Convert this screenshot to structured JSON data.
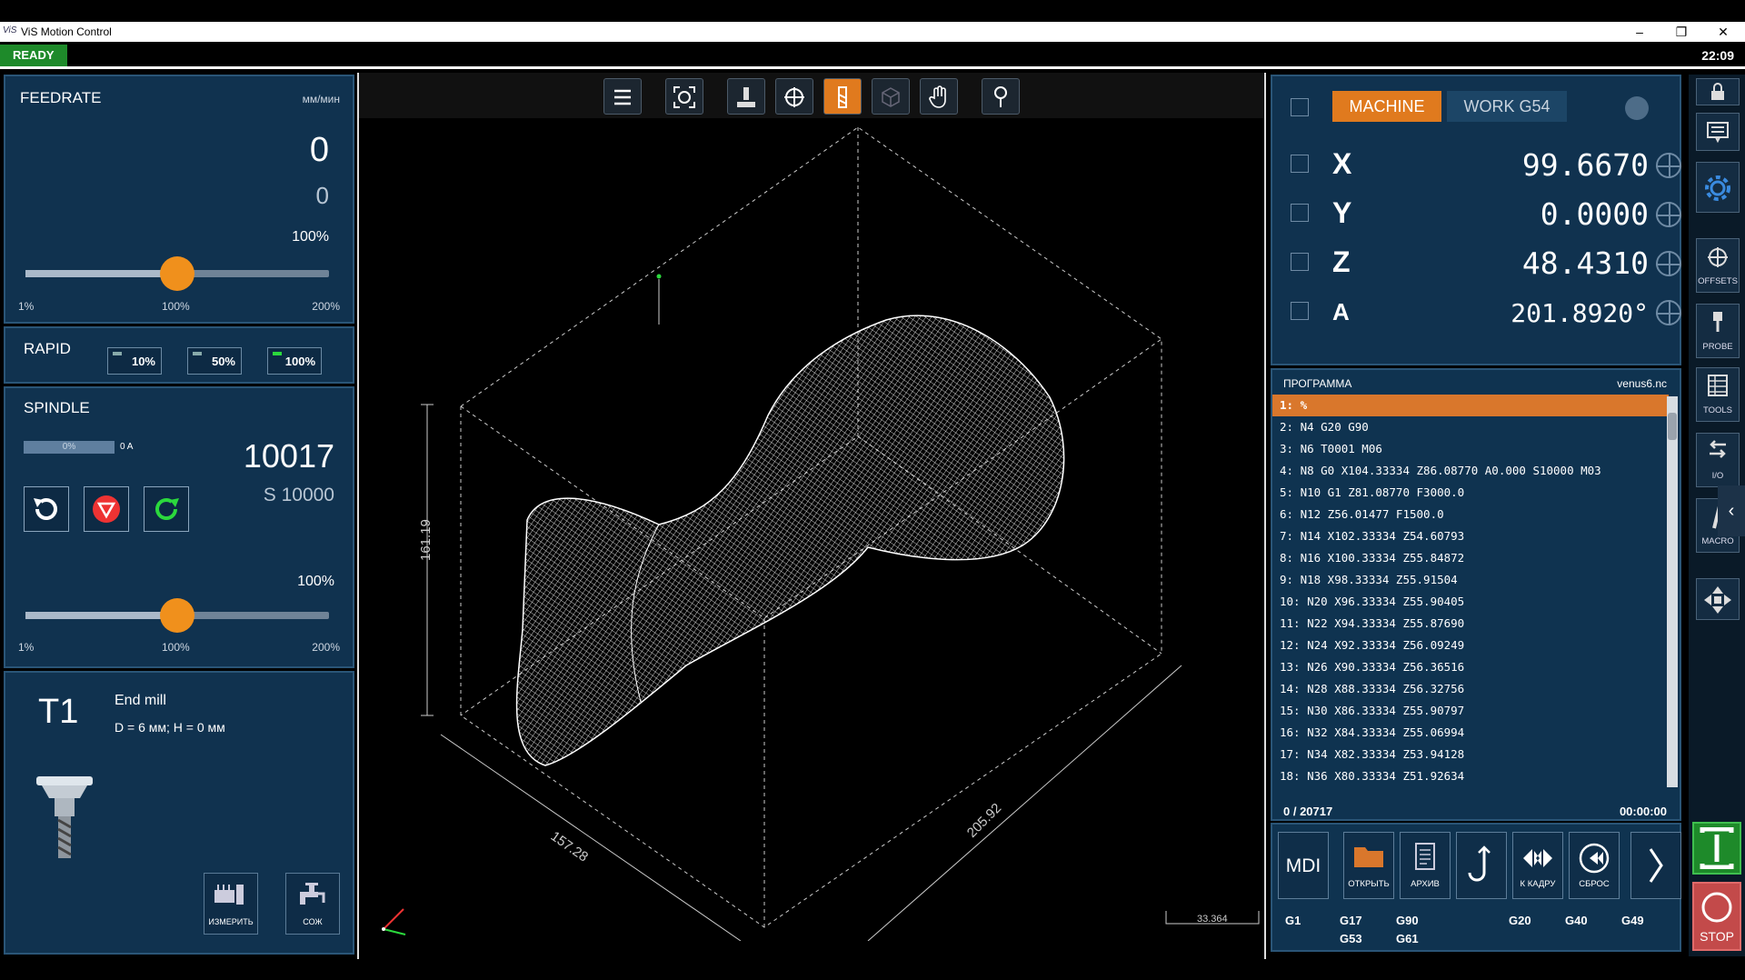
{
  "window": {
    "logo": "ViS",
    "title": "ViS Motion Control",
    "min": "–",
    "max": "❐",
    "close": "✕"
  },
  "status": {
    "state": "READY",
    "clock": "22:09"
  },
  "feedrate": {
    "title": "FEEDRATE",
    "unit": "мм/мин",
    "value": "0",
    "set": "0",
    "percent": "100%",
    "slider_level": 0.5,
    "min": "1%",
    "mid": "100%",
    "max": "200%"
  },
  "rapid": {
    "title": "RAPID",
    "btn1": "10%",
    "btn2": "50%",
    "btn3": "100%",
    "active": "100%"
  },
  "spindle": {
    "title": "SPINDLE",
    "load": "0%",
    "amp": "0 A",
    "rpm": "10017",
    "set": "S 10000",
    "percent": "100%",
    "slider_level": 0.5,
    "min": "1%",
    "mid": "100%",
    "max": "200%"
  },
  "tool": {
    "number": "T1",
    "name": "End mill",
    "dims": "D = 6 мм; H = 0 мм",
    "measure": "ИЗМЕРИТЬ",
    "coolant": "СОЖ"
  },
  "viewer": {
    "dim_height": "161.19",
    "dim_depth": "157.28",
    "dim_width": "205.92",
    "scale": "33.364"
  },
  "coords": {
    "machine": "MACHINE",
    "work": "WORK G54",
    "axes": [
      {
        "name": "X",
        "value": "99.6670"
      },
      {
        "name": "Y",
        "value": "0.0000"
      },
      {
        "name": "Z",
        "value": "48.4310"
      },
      {
        "name": "A",
        "value": "201.8920°"
      }
    ]
  },
  "program": {
    "title": "ПРОГРАММА",
    "file": "venus6.nc",
    "progress": "0 / 20717",
    "time": "00:00:00",
    "lines": [
      "1: %",
      "2: N4 G20 G90",
      "3: N6 T0001 M06",
      "4: N8 G0 X104.33334 Z86.08770 A0.000 S10000 M03",
      "5: N10 G1 Z81.08770 F3000.0",
      "6: N12 Z56.01477 F1500.0",
      "7: N14 X102.33334 Z54.60793",
      "8: N16 X100.33334 Z55.84872",
      "9: N18 X98.33334 Z55.91504",
      "10: N20 X96.33334 Z55.90405",
      "11: N22 X94.33334 Z55.87690",
      "12: N24 X92.33334 Z56.09249",
      "13: N26 X90.33334 Z56.36516",
      "14: N28 X88.33334 Z56.32756",
      "15: N30 X86.33334 Z55.90797",
      "16: N32 X84.33334 Z55.06994",
      "17: N34 X82.33334 Z53.94128",
      "18: N36 X80.33334 Z51.92634"
    ]
  },
  "controls": {
    "mdi": "MDI",
    "open": "ОТКРЫТЬ",
    "archive": "АРХИВ",
    "goto": "К КАДРУ",
    "reset": "СБРОС"
  },
  "gcodes": {
    "g1": "G1",
    "g17": "G17",
    "g53": "G53",
    "g90": "G90",
    "g61": "G61",
    "g20": "G20",
    "g40": "G40",
    "g49": "G49"
  },
  "side": {
    "offsets": "OFFSETS",
    "probe": "PROBE",
    "tools": "TOOLS",
    "io": "I/O",
    "macro": "MACRO",
    "stop": "STOP"
  },
  "colors": {
    "accent": "#e07a1e",
    "panel": "#10324f",
    "ready": "#1e8a2a",
    "active": "#2bd93d"
  }
}
